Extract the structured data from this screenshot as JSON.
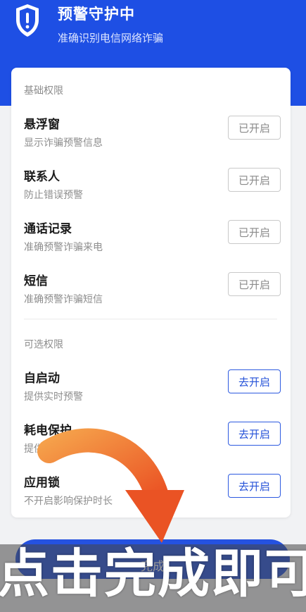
{
  "header": {
    "title": "预警守护中",
    "subtitle": "准确识别电信网络诈骗",
    "bg_color": "#1e4fe4"
  },
  "basic_section": {
    "label": "基础权限",
    "items": [
      {
        "title": "悬浮窗",
        "desc": "显示诈骗预警信息",
        "button": "已开启"
      },
      {
        "title": "联系人",
        "desc": "防止错误预警",
        "button": "已开启"
      },
      {
        "title": "通话记录",
        "desc": "准确预警诈骗来电",
        "button": "已开启"
      },
      {
        "title": "短信",
        "desc": "准确预警诈骗短信",
        "button": "已开启"
      }
    ]
  },
  "optional_section": {
    "label": "可选权限",
    "items": [
      {
        "title": "自启动",
        "desc": "提供实时预警",
        "button": "去开启"
      },
      {
        "title": "耗电保护",
        "desc": "提供实时预警",
        "button": "去开启"
      },
      {
        "title": "应用锁",
        "desc": "不开启影响保护时长",
        "button": "去开启"
      }
    ]
  },
  "footer": {
    "button_label": "完成",
    "button_color": "#2552e0"
  },
  "overlay": {
    "caption": "点击完成即可",
    "arrow_color": "#f06a2c"
  },
  "icons": {
    "shield": "shield-icon",
    "arrow": "curved-arrow-icon"
  }
}
